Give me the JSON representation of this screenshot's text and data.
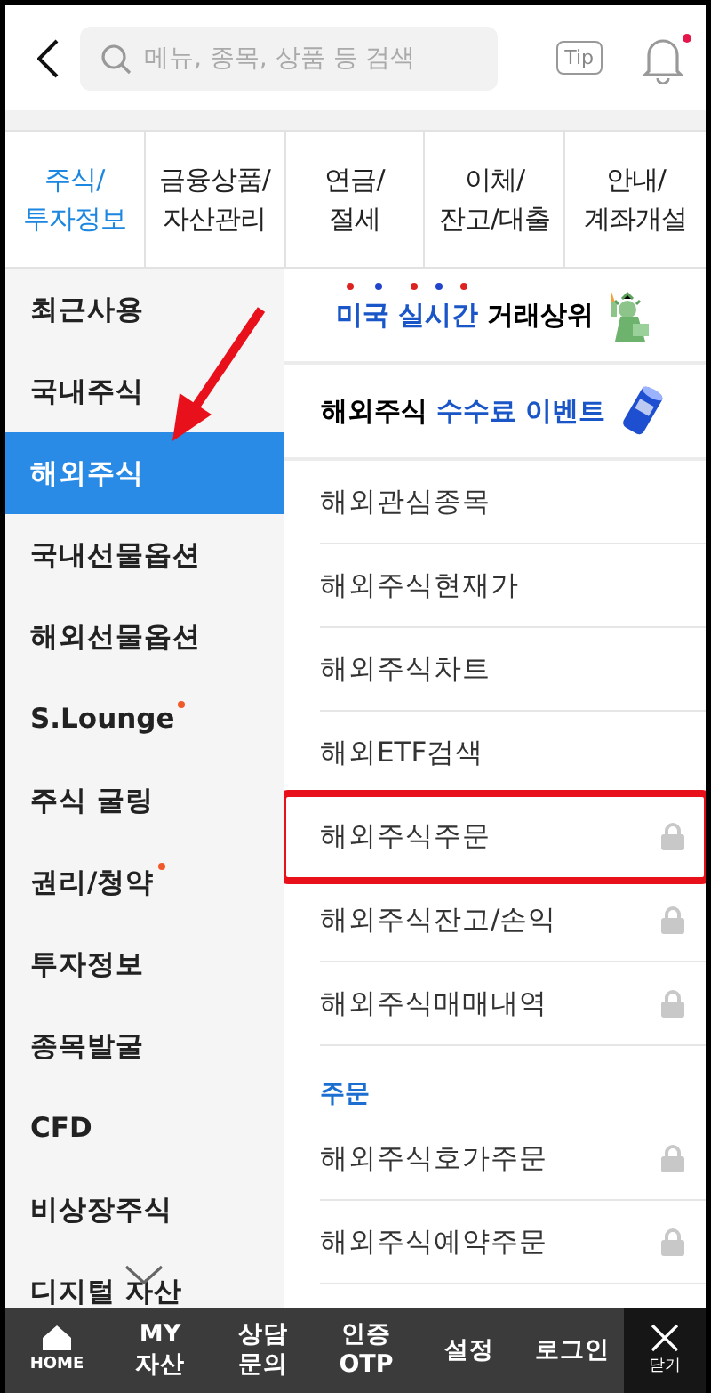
{
  "header": {
    "search": {
      "placeholder": "메뉴, 종목, 상품 등 검색"
    },
    "tip": "Tip",
    "notification": true
  },
  "tabs": [
    {
      "label": "주식/\n투자정보",
      "selected": true
    },
    {
      "label": "금융상품/\n자산관리",
      "selected": false
    },
    {
      "label": "연금/\n절세",
      "selected": false
    },
    {
      "label": "이체/\n잔고/대출",
      "selected": false
    },
    {
      "label": "안내/\n계좌개설",
      "selected": false
    }
  ],
  "sidebar": {
    "items": [
      {
        "label": "최근사용",
        "selected": false,
        "new": false
      },
      {
        "label": "국내주식",
        "selected": false,
        "new": false
      },
      {
        "label": "해외주식",
        "selected": true,
        "new": false
      },
      {
        "label": "국내선물옵션",
        "selected": false,
        "new": false
      },
      {
        "label": "해외선물옵션",
        "selected": false,
        "new": false
      },
      {
        "label": "S.Lounge",
        "selected": false,
        "new": true
      },
      {
        "label": "주식 굴링",
        "selected": false,
        "new": false
      },
      {
        "label": "권리/청약",
        "selected": false,
        "new": true
      },
      {
        "label": "투자정보",
        "selected": false,
        "new": false
      },
      {
        "label": "종목발굴",
        "selected": false,
        "new": false
      },
      {
        "label": "CFD",
        "selected": false,
        "new": false
      },
      {
        "label": "비상장주식",
        "selected": false,
        "new": false
      },
      {
        "label": "디지털 자산",
        "selected": false,
        "new": false
      }
    ]
  },
  "banners": [
    {
      "kind": "statue",
      "text": "**미국 실시간** 거래상위"
    },
    {
      "kind": "can",
      "text": "해외주식 **수수료 이벤트**"
    }
  ],
  "menu": [
    {
      "kind": "item",
      "label": "해외관심종목",
      "locked": false
    },
    {
      "kind": "item",
      "label": "해외주식현재가",
      "locked": false
    },
    {
      "kind": "item",
      "label": "해외주식차트",
      "locked": false
    },
    {
      "kind": "item",
      "label": "해외ETF검색",
      "locked": false
    },
    {
      "kind": "item",
      "label": "해외주식주문",
      "locked": true,
      "boxed": true
    },
    {
      "kind": "item",
      "label": "해외주식잔고/손익",
      "locked": true
    },
    {
      "kind": "item",
      "label": "해외주식매매내역",
      "locked": true
    },
    {
      "kind": "section",
      "label": "주문"
    },
    {
      "kind": "item",
      "label": "해외주식호가주문",
      "locked": true
    },
    {
      "kind": "item",
      "label": "해외주식예약주문",
      "locked": true
    }
  ],
  "annotations": [
    {
      "kind": "arrow"
    }
  ],
  "bottom_nav": [
    {
      "kind": "home",
      "label": "HOME"
    },
    {
      "kind": "text",
      "label": "MY\n자산"
    },
    {
      "kind": "text",
      "label": "상담\n문의"
    },
    {
      "kind": "text",
      "label": "인증\nOTP"
    },
    {
      "kind": "text",
      "label": "설정"
    },
    {
      "kind": "text",
      "label": "로그인"
    },
    {
      "kind": "close",
      "label": "닫기"
    }
  ]
}
